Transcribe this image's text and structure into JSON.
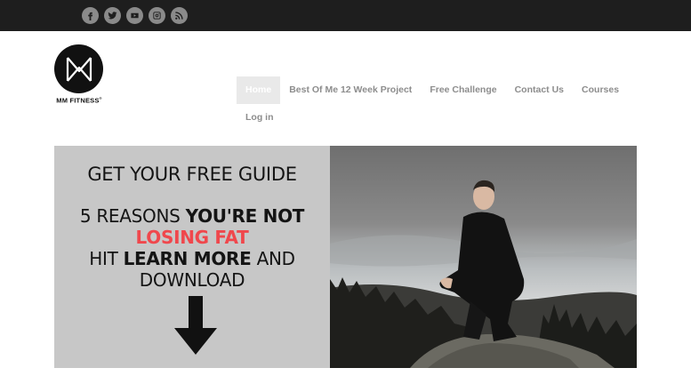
{
  "social": [
    {
      "name": "facebook-icon"
    },
    {
      "name": "twitter-icon"
    },
    {
      "name": "youtube-icon"
    },
    {
      "name": "instagram-icon"
    },
    {
      "name": "rss-icon"
    }
  ],
  "brand": {
    "name": "MM FITNESS",
    "mark": "®"
  },
  "nav": {
    "items": [
      "Home",
      "Best Of Me 12 Week Project",
      "Free Challenge",
      "Contact Us",
      "Courses"
    ],
    "login": "Log in",
    "active_index": 0
  },
  "hero": {
    "title": "GET YOUR FREE GUIDE",
    "line1_a": "5 REASONS ",
    "line1_b": "YOU'RE NOT",
    "line2": "LOSING FAT",
    "line3_a": "HIT ",
    "line3_b": "LEARN MORE",
    "line3_c": " AND",
    "line4": "DOWNLOAD"
  },
  "colors": {
    "topbar": "#1e1e1e",
    "accent_red": "#f0474c",
    "nav_text": "#8d8d8d",
    "panel_bg": "#c7c7c7"
  }
}
